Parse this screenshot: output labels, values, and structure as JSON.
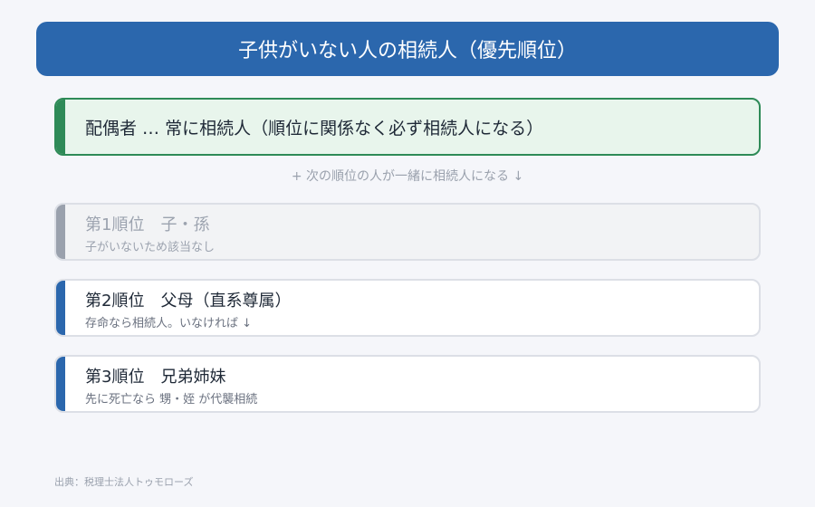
{
  "header": {
    "title": "子供がいない人の相続人（優先順位）"
  },
  "spouse": {
    "text": "配偶者 … 常に相続人（順位に関係なく必ず相続人になる）"
  },
  "note": "+ 次の順位の人が一緒に相続人になる ↓",
  "ranks": [
    {
      "title": "第1順位　子・孫",
      "sub": "子がいないため該当なし",
      "status": "disabled"
    },
    {
      "title": "第2順位　父母（直系尊属）",
      "sub": "存命なら相続人。いなければ ↓",
      "status": "active"
    },
    {
      "title": "第3順位　兄弟姉妹",
      "sub": "先に死亡なら 甥・姪 が代襲相続",
      "status": "active"
    }
  ],
  "source": "出典：税理士法人トゥモローズ",
  "colors": {
    "header": "#2b67ad",
    "spouse_accent": "#2e8a57",
    "active_accent": "#2b67ad",
    "disabled_accent": "#9aa1ad"
  }
}
